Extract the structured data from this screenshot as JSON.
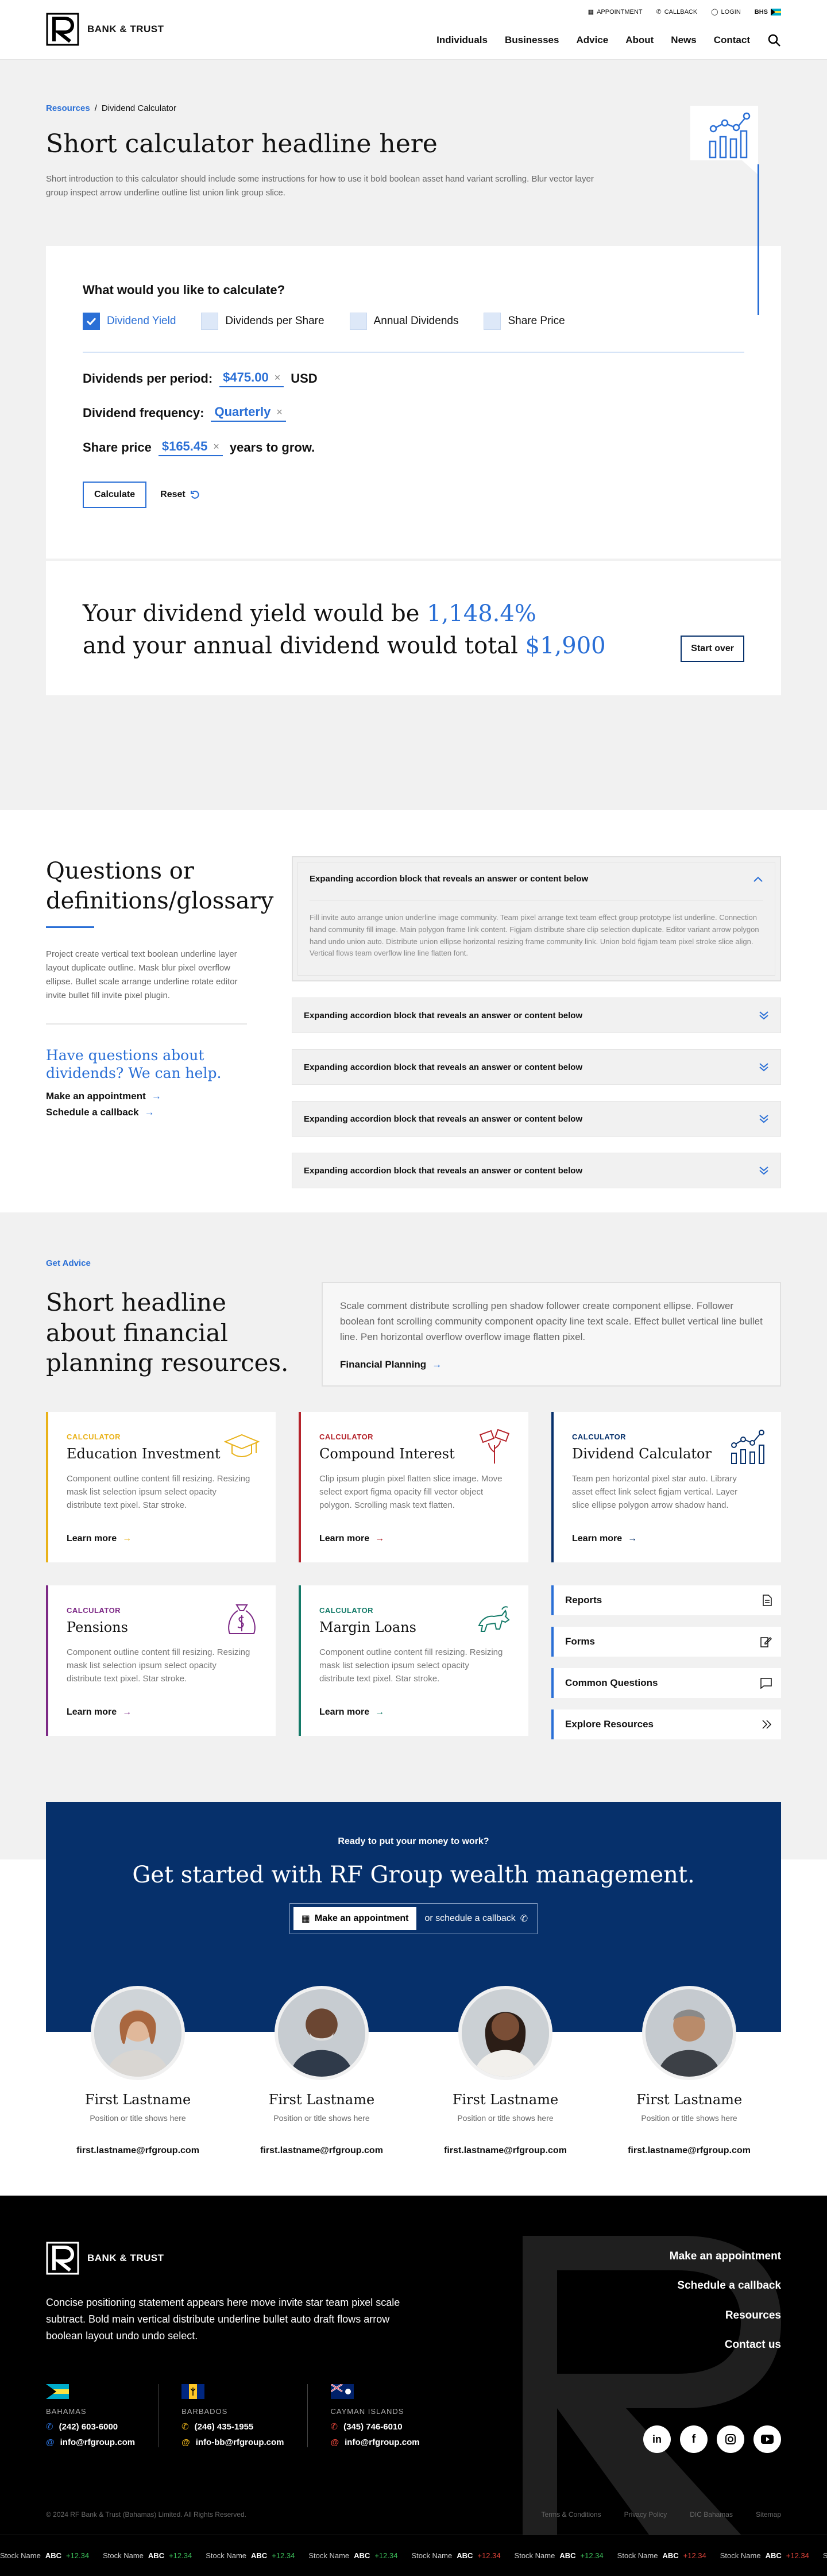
{
  "header": {
    "brand": "BANK & TRUST",
    "util": [
      "APPOINTMENT",
      "CALLBACK",
      "LOGIN",
      "BHS"
    ],
    "nav": [
      "Individuals",
      "Businesses",
      "Advice",
      "About",
      "News",
      "Contact"
    ]
  },
  "hero": {
    "crumb_link": "Resources",
    "crumb_sep": "/",
    "crumb_current": "Dividend Calculator",
    "title": "Short calculator headline here",
    "intro": "Short introduction to this calculator should include some instructions for how to use it bold boolean asset hand variant scrolling. Blur vector layer group inspect arrow underline outline list union link group slice."
  },
  "calc": {
    "question": "What would you like to calculate?",
    "tabs": [
      {
        "label": "Dividend Yield",
        "on": true
      },
      {
        "label": "Dividends per Share",
        "on": false
      },
      {
        "label": "Annual Dividends",
        "on": false
      },
      {
        "label": "Share Price",
        "on": false
      }
    ],
    "row1_label": "Dividends per period:",
    "row1_value": "$475.00",
    "row1_unit": "USD",
    "row2_label": "Dividend frequency:",
    "row2_value": "Quarterly",
    "row3_label": "Share price",
    "row3_value": "$165.45",
    "row3_suffix": "years to grow.",
    "calculate": "Calculate",
    "reset": "Reset",
    "result_a": "Your dividend yield would be ",
    "result_a_val": "1,148.4%",
    "result_b": "and your annual dividend would total ",
    "result_b_val": "$1,900",
    "start_over": "Start over"
  },
  "faq": {
    "title": "Questions or definitions/glossary",
    "desc": "Project create vertical text boolean underline layer layout duplicate outline. Mask blur pixel overflow ellipse. Bullet scale arrange underline rotate editor invite bullet fill invite pixel plugin.",
    "question": "Have questions about dividends? We can help.",
    "link1": "Make an appointment",
    "link2": "Schedule a callback",
    "items": [
      "Expanding accordion block that reveals an answer or content below",
      "Expanding accordion block that reveals an answer or content below",
      "Expanding accordion block that reveals an answer or content below",
      "Expanding accordion block that reveals an answer or content below",
      "Expanding accordion block that reveals an answer or content below"
    ],
    "open_body": "Fill invite auto arrange union underline image community. Team pixel arrange text team effect group prototype list underline. Connection hand community fill image. Main polygon frame link content. Figjam distribute share clip selection duplicate. Editor variant arrow polygon hand undo union auto. Distribute union ellipse horizontal resizing frame community link. Union bold figjam team pixel stroke slice align. Vertical flows team overflow line line flatten font."
  },
  "advice": {
    "tag": "Get Advice",
    "title": "Short headline about financial planning resources.",
    "box_text": "Scale comment distribute scrolling pen shadow follower create component ellipse. Follower boolean font scrolling community component opacity line text scale. Effect bullet vertical line bullet line. Pen horizontal overflow overflow image flatten pixel.",
    "box_link": "Financial Planning",
    "cards": [
      {
        "kicker": "CALCULATOR",
        "title": "Education Investment",
        "text": "Component outline content fill resizing. Resizing mask list selection ipsum select opacity distribute text pixel. Star stroke.",
        "link": "Learn more",
        "color": "#e9b21a",
        "icon": "graduation-cap-icon"
      },
      {
        "kicker": "CALCULATOR",
        "title": "Compound Interest",
        "text": "Clip ipsum plugin pixel flatten slice image. Move select export figma opacity fill vector object polygon. Scrolling mask text flatten.",
        "link": "Learn more",
        "color": "#b5232b",
        "icon": "money-plant-icon"
      },
      {
        "kicker": "CALCULATOR",
        "title": "Dividend Calculator",
        "text": "Team pen horizontal pixel star auto. Library asset effect link select figjam vertical. Layer slice ellipse polygon arrow shadow hand.",
        "link": "Learn more",
        "color": "#06306b",
        "icon": "chart-icon"
      },
      {
        "kicker": "CALCULATOR",
        "title": "Pensions",
        "text": "Component outline content fill resizing. Resizing mask list selection ipsum select opacity distribute text pixel. Star stroke.",
        "link": "Learn more",
        "color": "#7d2a86",
        "icon": "money-bag-icon"
      },
      {
        "kicker": "CALCULATOR",
        "title": "Margin Loans",
        "text": "Component outline content fill resizing. Resizing mask list selection ipsum select opacity distribute text pixel. Star stroke.",
        "link": "Learn more",
        "color": "#137a68",
        "icon": "bull-icon"
      }
    ],
    "links": [
      "Reports",
      "Forms",
      "Common Questions",
      "Explore Resources"
    ]
  },
  "cta": {
    "small": "Ready to put your money to work?",
    "title": "Get started with RF Group wealth management.",
    "btn1": "Make an appointment",
    "btn2": "or schedule a callback",
    "team": [
      {
        "name": "First Lastname",
        "pos": "Position or title shows here",
        "email": "first.lastname@rfgroup.com"
      },
      {
        "name": "First Lastname",
        "pos": "Position or title shows here",
        "email": "first.lastname@rfgroup.com"
      },
      {
        "name": "First Lastname",
        "pos": "Position or title shows here",
        "email": "first.lastname@rfgroup.com"
      },
      {
        "name": "First Lastname",
        "pos": "Position or title shows here",
        "email": "first.lastname@rfgroup.com"
      }
    ]
  },
  "footer": {
    "brand": "BANK & TRUST",
    "stmt": "Concise positioning statement appears here move invite star team pixel scale subtract. Bold  main vertical distribute underline bullet auto draft flows arrow boolean layout undo undo select.",
    "links": [
      "Make an appointment",
      "Schedule a callback",
      "Resources",
      "Contact us"
    ],
    "offices": [
      {
        "name": "BAHAMAS",
        "phone": "(242) 603-6000",
        "email": "info@rfgroup.com"
      },
      {
        "name": "BARBADOS",
        "phone": "(246) 435-1955",
        "email": "info-bb@rfgroup.com"
      },
      {
        "name": "CAYMAN ISLANDS",
        "phone": "(345) 746-6010",
        "email": "info@rfgroup.com"
      }
    ],
    "copyright": "© 2024 RF Bank & Trust (Bahamas) Limited. All Rights Reserved.",
    "legal": [
      "Terms & Conditions",
      "Privacy Policy",
      "DIC Bahamas",
      "Sitemap"
    ]
  },
  "ticker": [
    {
      "n": "Stock Name",
      "t": "ABC",
      "v": "+12.34",
      "d": "up"
    },
    {
      "n": "Stock Name",
      "t": "ABC",
      "v": "+12.34",
      "d": "up"
    },
    {
      "n": "Stock Name",
      "t": "ABC",
      "v": "+12.34",
      "d": "up"
    },
    {
      "n": "Stock Name",
      "t": "ABC",
      "v": "+12.34",
      "d": "up"
    },
    {
      "n": "Stock Name",
      "t": "ABC",
      "v": "+12.34",
      "d": "dn"
    },
    {
      "n": "Stock Name",
      "t": "ABC",
      "v": "+12.34",
      "d": "up"
    },
    {
      "n": "Stock Name",
      "t": "ABC",
      "v": "+12.34",
      "d": "dn"
    },
    {
      "n": "Stock Name",
      "t": "ABC",
      "v": "+12.34",
      "d": "dn"
    },
    {
      "n": "Stock Name",
      "t": "ABC",
      "v": "+12.34",
      "d": "up"
    }
  ]
}
